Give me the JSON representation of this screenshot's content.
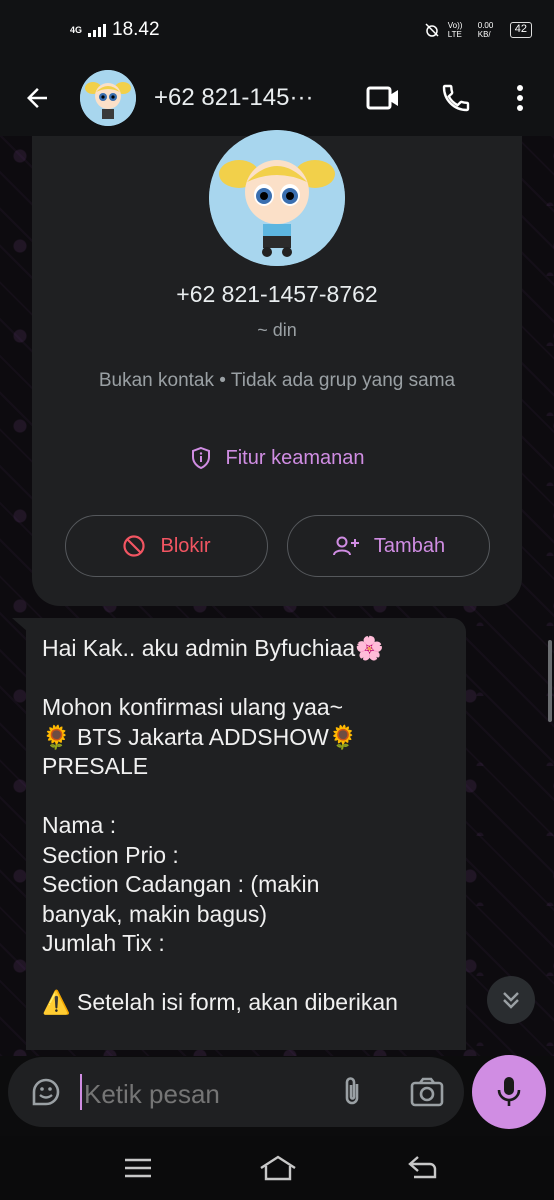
{
  "status_bar": {
    "network": "4G",
    "time": "18.42",
    "volte": "Vo)) LTE",
    "speed": "0.00 KB/",
    "battery": "42"
  },
  "header": {
    "title": "+62 821-145···",
    "icons": [
      "back-arrow-icon",
      "video-call-icon",
      "phone-icon",
      "more-vert-icon"
    ]
  },
  "contact_card": {
    "phone": "+62 821-1457-8762",
    "push_name": "~ din",
    "sub_info": "Bukan kontak • Tidak ada grup yang sama",
    "security_label": "Fitur keamanan",
    "block_label": "Blokir",
    "add_label": "Tambah"
  },
  "message": {
    "text": "Hai Kak.. aku admin Byfuchiaa🌸\n\nMohon konfirmasi ulang yaa~\n🌻 BTS Jakarta ADDSHOW🌻\nPRESALE\n\nNama :\nSection Prio :\nSection Cadangan : (makin\nbanyak, makin bagus)\nJumlah Tix :\n\n⚠️ Setelah isi form, akan diberikan"
  },
  "composer": {
    "placeholder": "Ketik pesan"
  },
  "colors": {
    "accent": "#d08de3",
    "danger": "#f25562",
    "bubble": "#1f2022",
    "bar": "#111214"
  }
}
